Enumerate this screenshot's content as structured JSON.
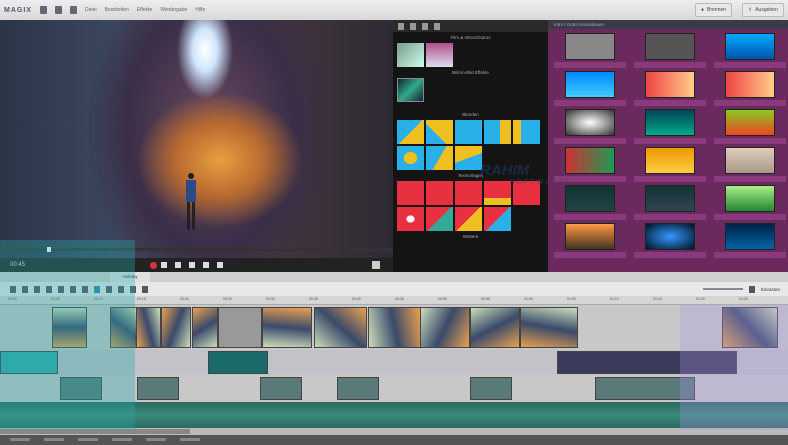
{
  "app": {
    "logo": "MAGIX",
    "menu": [
      "Datei",
      "Bearbeiten",
      "Effekte",
      "Wiedergabe",
      "Hilfe"
    ],
    "burn_button": "Brennen",
    "export_button": "Ausgeben"
  },
  "preview": {
    "timecode": "00:45"
  },
  "templates_panel": {
    "sections": [
      "Film & Intros/Outros",
      "Bild-in-Bild Effekte",
      "Blenden",
      "Textvorlagen",
      "Weitere"
    ]
  },
  "media_panel": {
    "path": "Intro / Outro Animationen"
  },
  "timeline": {
    "tab": "Holiday",
    "ruler": [
      "00:00",
      "00:05",
      "00:10",
      "00:15",
      "00:20",
      "00:25",
      "00:30",
      "00:35",
      "00:40",
      "00:45",
      "00:50",
      "00:55",
      "01:00",
      "01:05",
      "01:10",
      "01:15",
      "01:20",
      "01:25"
    ],
    "zoom_label": "Einrasten"
  },
  "watermark": {
    "line1": "RAHIM",
    "line2": "SOFTWARES"
  },
  "colors": {
    "accent": "#2aa7a7",
    "media_bg": "#6a2a5e",
    "record": "#e03040"
  }
}
